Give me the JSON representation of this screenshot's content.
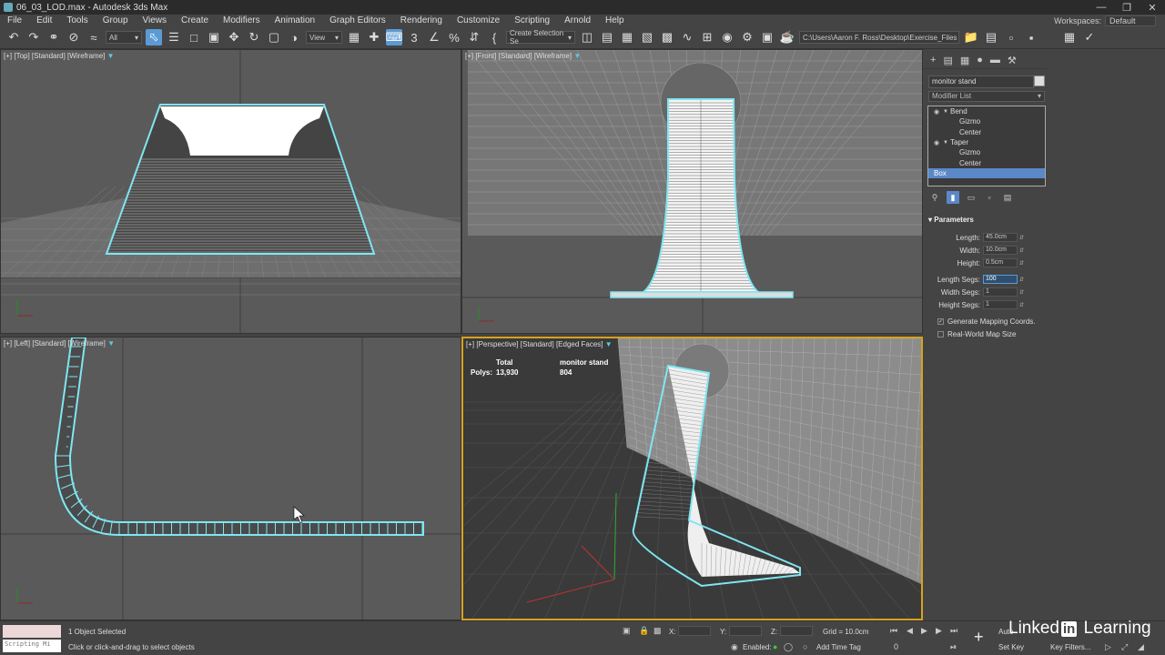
{
  "window": {
    "title": "06_03_LOD.max - Autodesk 3ds Max"
  },
  "menu": [
    "File",
    "Edit",
    "Tools",
    "Group",
    "Views",
    "Create",
    "Modifiers",
    "Animation",
    "Graph Editors",
    "Rendering",
    "Customize",
    "Scripting",
    "Arnold",
    "Help"
  ],
  "workspace": {
    "label": "Workspaces:",
    "value": "Default"
  },
  "toolbar": {
    "filter": "All",
    "ref_coord": "View",
    "selection_set": "Create Selection Se",
    "path": "C:\\Users\\Aaron F. Ross\\Desktop\\Exercise_Files"
  },
  "viewports": {
    "top": {
      "label": "[+] [Top] [Standard] [Wireframe]"
    },
    "front": {
      "label": "[+] [Front] [Standard] [Wireframe]"
    },
    "left": {
      "label": "[+] [Left] [Standard] [Wireframe]"
    },
    "perspective": {
      "label": "[+] [Perspective] [Standard] [Edged Faces]"
    }
  },
  "stats": {
    "col1": "Total",
    "col2": "monitor stand",
    "row_label": "Polys:",
    "total": "13,930",
    "object": "804"
  },
  "command_panel": {
    "object_name": "monitor stand",
    "modifier_list": "Modifier List",
    "stack": [
      {
        "name": "Bend",
        "type": "modifier"
      },
      {
        "name": "Gizmo",
        "type": "sub"
      },
      {
        "name": "Center",
        "type": "sub"
      },
      {
        "name": "Taper",
        "type": "modifier"
      },
      {
        "name": "Gizmo",
        "type": "sub"
      },
      {
        "name": "Center",
        "type": "sub"
      },
      {
        "name": "Box",
        "type": "base"
      }
    ],
    "rollout_title": "Parameters",
    "params": [
      {
        "label": "Length:",
        "value": "45.0cm"
      },
      {
        "label": "Width:",
        "value": "10.0cm"
      },
      {
        "label": "Height:",
        "value": "0.5cm"
      },
      {
        "label": "Length Segs:",
        "value": "100"
      },
      {
        "label": "Width Segs:",
        "value": "1"
      },
      {
        "label": "Height Segs:",
        "value": "1"
      }
    ],
    "generate_mapping": "Generate Mapping Coords.",
    "real_world": "Real-World Map Size"
  },
  "status": {
    "maxscript": "Scripting Mi",
    "selected": "1 Object Selected",
    "prompt": "Click or click-and-drag to select objects",
    "x_label": "X:",
    "y_label": "Y:",
    "z_label": "Z:",
    "grid": "Grid = 10.0cm",
    "enabled": "Enabled:",
    "add_time_tag": "Add Time Tag",
    "auto": "Auto",
    "set_key": "Set Key",
    "key_filters": "Key Filters...",
    "frame": "0"
  },
  "watermark": {
    "pre": "Linked",
    "in": "in",
    "post": " Learning"
  },
  "colors": {
    "accent": "#5b9bd5",
    "selection": "#7fe6f2",
    "active_viewport": "#d6a21f"
  }
}
